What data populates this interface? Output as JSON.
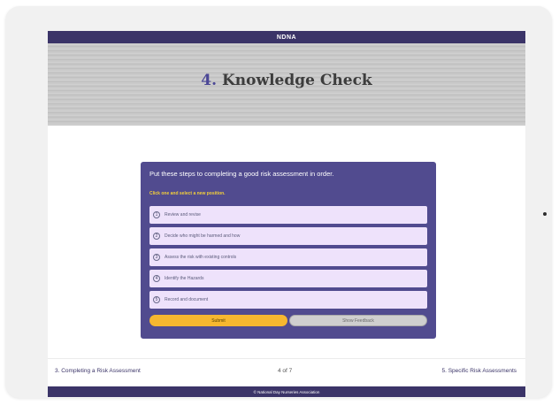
{
  "header": {
    "brand": "NDNA"
  },
  "hero": {
    "number": "4.",
    "title": "Knowledge Check"
  },
  "quiz": {
    "question": "Put these steps to completing a good risk assessment in order.",
    "instruction": "Click one and select a new position.",
    "options": [
      {
        "num": "1",
        "label": "Review and revise"
      },
      {
        "num": "2",
        "label": "Decide who might be harmed and how"
      },
      {
        "num": "3",
        "label": "Assess the risk with existing controls"
      },
      {
        "num": "4",
        "label": "Identify the Hazards"
      },
      {
        "num": "5",
        "label": "Record and document"
      }
    ],
    "submit_label": "Submit",
    "feedback_label": "Show Feedback"
  },
  "nav": {
    "prev_label": "3. Completing a Risk Assessment",
    "page_indicator": "4 of 7",
    "next_label": "5. Specific Risk Assessments"
  },
  "footer": {
    "copyright": "© National Day Nurseries Association"
  },
  "colors": {
    "brand_purple": "#3b3468",
    "quiz_bg": "#514b8f",
    "option_bg": "#eee2fb",
    "instruction_yellow": "#f3cf3a",
    "submit_yellow": "#f6b730"
  }
}
